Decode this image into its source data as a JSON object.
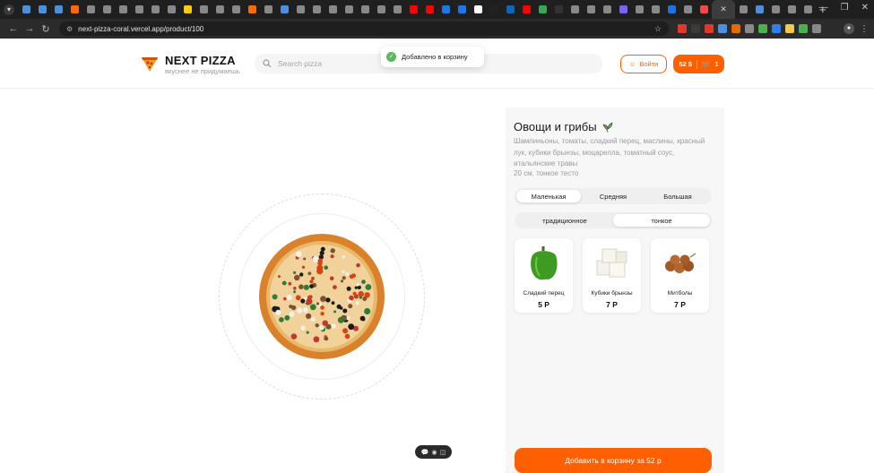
{
  "browser": {
    "url": "next-pizza-coral.vercel.app/product/100",
    "tab_favicons": [
      "#4a90e2",
      "#4a90e2",
      "#4a90e2",
      "#ff6a00",
      "#888",
      "#888",
      "#888",
      "#888",
      "#888",
      "#888",
      "#ffcc00",
      "#888",
      "#888",
      "#888",
      "#ff6a00",
      "#888",
      "#4a90e2",
      "#888",
      "#888",
      "#888",
      "#888",
      "#888",
      "#888",
      "#888",
      "#ff0000",
      "#ff0000",
      "#1877f2",
      "#1877f2",
      "#ffffff",
      "#222",
      "#0a66c2",
      "#ff0000",
      "#34a853",
      "#333",
      "#888",
      "#888",
      "#888",
      "#7b61ff",
      "#888",
      "#888",
      "#1a73e8",
      "#888",
      "#ff4444",
      "#888",
      "#4a90e2",
      "#888",
      "#888",
      "#888"
    ],
    "new_tab_label": "+",
    "extension_colors": [
      "#e0392b",
      "#3a3a3a",
      "#e0392b",
      "#4a90e2",
      "#e56b00",
      "#8a8a8a",
      "#4caf50",
      "#2f80ed",
      "#f2c94c",
      "#4caf50",
      "#888"
    ]
  },
  "header": {
    "logo_title": "NEXT PIZZA",
    "logo_subtitle": "вкуснее не придумаешь",
    "search_placeholder": "Search pizza",
    "login_label": "Войти",
    "cart_total": "52 $",
    "cart_count": "1"
  },
  "toast": {
    "message": "Добавлено в корзину"
  },
  "product": {
    "title": "Овощи и грибы",
    "description": "Шампиньоны, томаты, сладкий перец, маслины, красный лук, кубики брынзы, моцарелла, томатный соус, итальянские травы",
    "meta": "20 см, тонкое тесто",
    "sizes": [
      "Маленькая",
      "Средняя",
      "Большая"
    ],
    "selected_size": "Маленькая",
    "dough_types": [
      "традиционное",
      "тонкое"
    ],
    "selected_dough": "тонкое",
    "ingredients": [
      {
        "name": "Сладкий перец",
        "price": "5 Р",
        "icon": "bell-pepper-icon"
      },
      {
        "name": "Кубики брынзы",
        "price": "7 Р",
        "icon": "cheese-cubes-icon"
      },
      {
        "name": "Митболы",
        "price": "7 Р",
        "icon": "meatballs-icon"
      }
    ],
    "add_button_label": "Добавить в корзину за 52 р"
  },
  "colors": {
    "accent": "#fe5f00",
    "toast_success": "#5cb85c"
  }
}
